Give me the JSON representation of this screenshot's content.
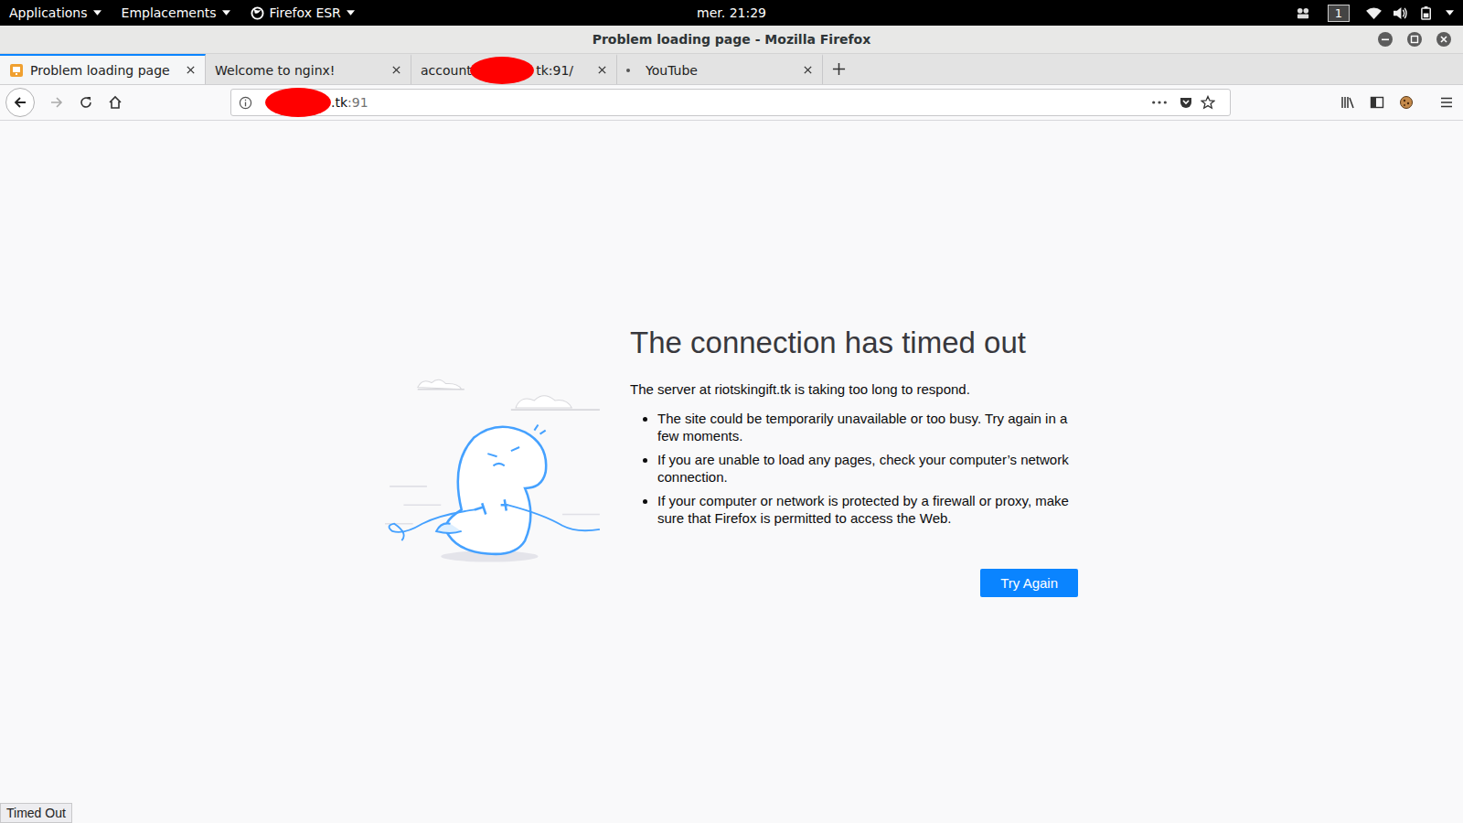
{
  "top_bar": {
    "menus": [
      {
        "label": "Applications",
        "kind": "menu"
      },
      {
        "label": "Emplacements",
        "kind": "menu"
      },
      {
        "label": "Firefox ESR",
        "kind": "app"
      }
    ],
    "clock": "mer. 21:29",
    "workspace": "1"
  },
  "window": {
    "title": "Problem loading page - Mozilla Firefox"
  },
  "tabs": [
    {
      "label": "Problem loading page",
      "label_end": "",
      "redacted": false,
      "selected": true,
      "error": true,
      "attention": false
    },
    {
      "label": "Welcome to nginx!",
      "label_end": "",
      "redacted": false,
      "selected": false,
      "error": false,
      "attention": false
    },
    {
      "label": "account.",
      "label_end": "tk:91/",
      "redacted": true,
      "selected": false,
      "error": false,
      "attention": false
    },
    {
      "label": "YouTube",
      "label_end": "",
      "redacted": false,
      "selected": false,
      "error": false,
      "attention": true
    }
  ],
  "url_bar": {
    "redacted": true,
    "host_visible": ".tk",
    "port": ":91"
  },
  "error": {
    "title": "The connection has timed out",
    "message": "The server at riotskingift.tk is taking too long to respond.",
    "bullets": [
      "The site could be temporarily unavailable or too busy. Try again in a few moments.",
      "If you are unable to load any pages, check your computer’s network connection.",
      "If your computer or network is protected by a firewall or proxy, make sure that Firefox is permitted to access the Web."
    ],
    "button": "Try Again"
  },
  "status": "Timed Out"
}
